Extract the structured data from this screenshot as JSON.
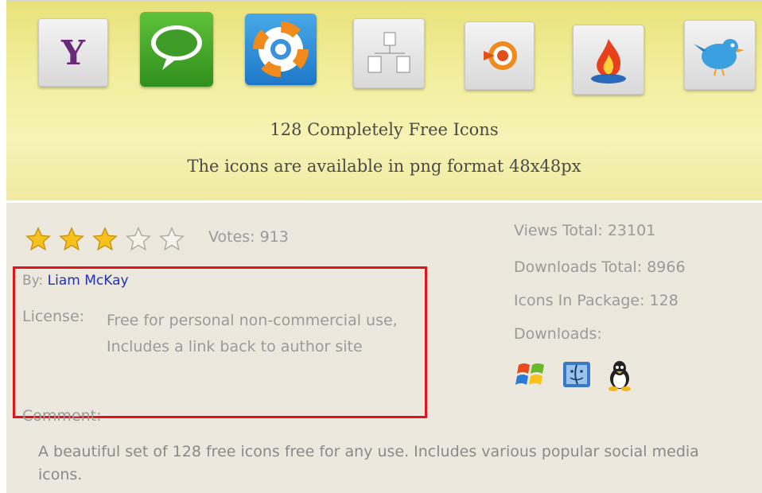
{
  "banner": {
    "title": "128 Completely Free Icons",
    "subtitle": "The icons are available in png format 48x48px",
    "icons": [
      "yahoo-icon",
      "speech-bubble-icon",
      "lifebuoy-icon",
      "org-chart-icon",
      "feed-target-icon",
      "feedburner-flame-icon",
      "twitter-bird-icon"
    ]
  },
  "rating": {
    "stars_filled": 3,
    "stars_total": 5,
    "votes_label": "Votes: 913"
  },
  "author": {
    "by_label": "By:",
    "name": "Liam McKay"
  },
  "license": {
    "label": "License:",
    "text": "Free for personal non-commercial use, Includes a link back to author site"
  },
  "comment": {
    "label": "Comment:",
    "text": "A beautiful set of 128 free icons free for any use. Includes various popular social media icons."
  },
  "stats": {
    "views": "Views Total: 23101",
    "downloads_total": "Downloads Total: 8966",
    "icons_in_package": "Icons In Package: 128",
    "downloads_label": "Downloads:"
  },
  "download_platforms": [
    "windows-icon",
    "mac-finder-icon",
    "linux-tux-icon"
  ],
  "colors": {
    "highlight_box": "#e0141a",
    "author_link": "#2233aa",
    "banner_bg": "#f2ee9c",
    "info_bg": "#ede8de"
  }
}
